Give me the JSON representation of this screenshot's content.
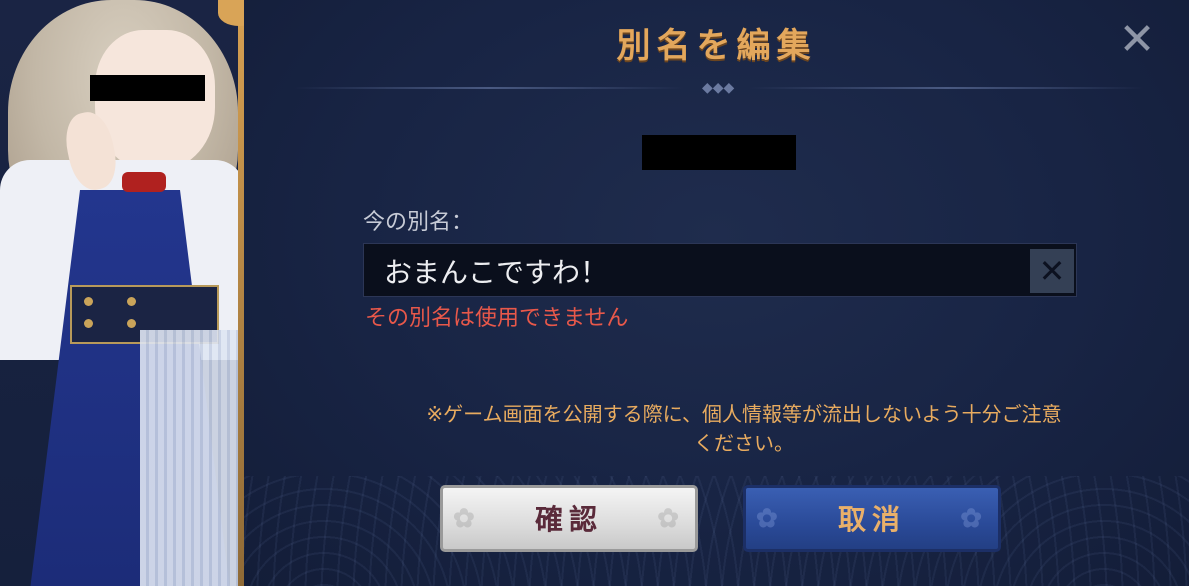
{
  "dialog": {
    "title": "別名を編集",
    "close_icon": "✕",
    "current_label": "今の別名：",
    "name_value": "おまんこですわ！",
    "clear_icon": "✕",
    "error": "その別名は使用できません",
    "notice_line1": "※ゲーム画面を公開する際に、個人情報等が流出しないよう十分ご注意",
    "notice_line2": "ください。",
    "confirm_label": "確認",
    "cancel_label": "取消"
  },
  "colors": {
    "title": "#e3a75c",
    "error": "#e8584a",
    "notice": "#e8ab5f",
    "panel_bg": "#182444"
  },
  "icons": {
    "close": "close-icon",
    "clear": "clear-icon",
    "divider": "diamond-ornament-icon"
  }
}
